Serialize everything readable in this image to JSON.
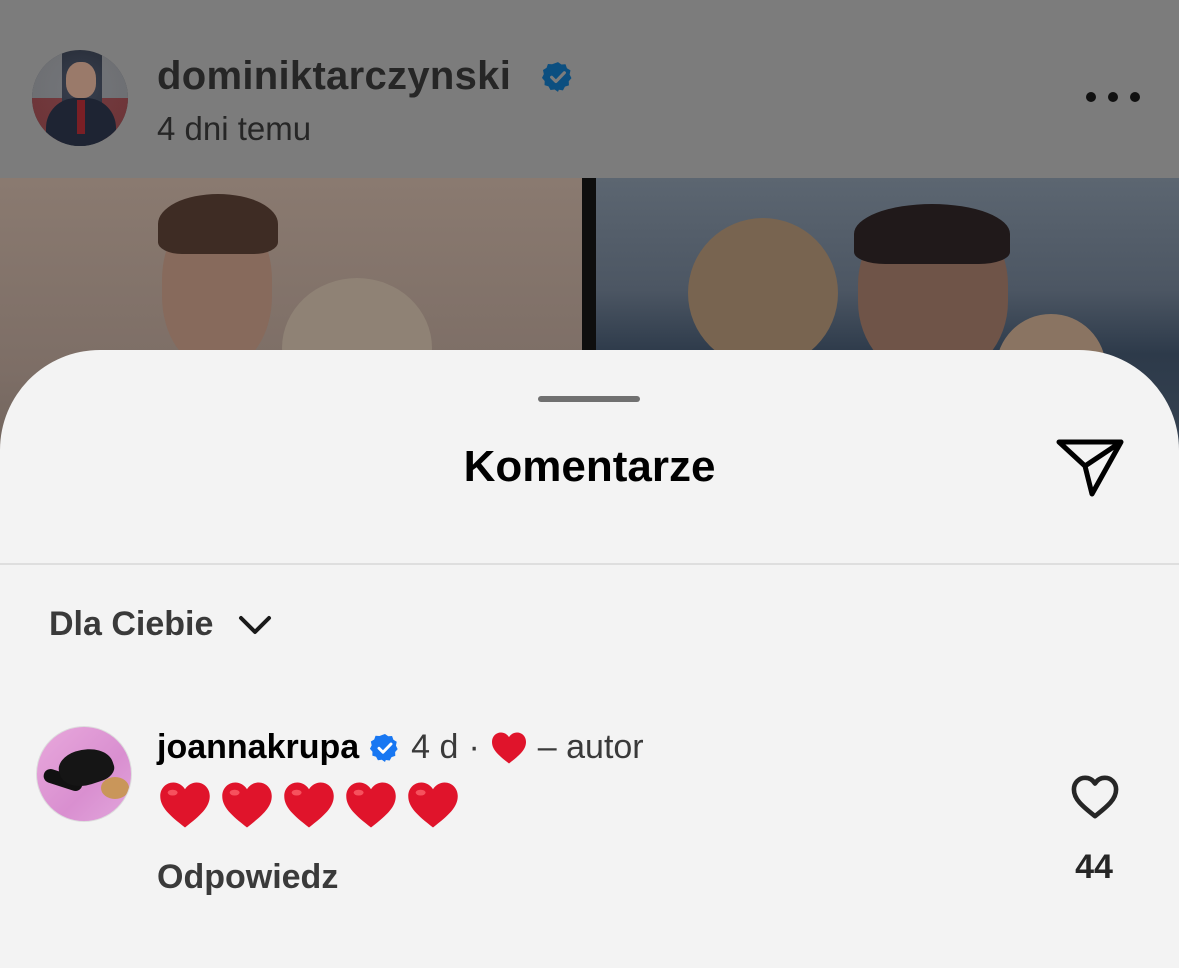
{
  "post": {
    "username": "dominiktarczynski",
    "time": "4 dni temu",
    "verified": true
  },
  "sheet": {
    "title": "Komentarze",
    "filter_label": "Dla Ciebie"
  },
  "comment": {
    "username": "joannakrupa",
    "verified": true,
    "age": "4 d",
    "separator": "·",
    "author_label": "– autor",
    "text_emoji": "❤️❤️❤️❤️❤️",
    "reply_label": "Odpowiedz",
    "like_count": "44"
  },
  "colors": {
    "verified_blue": "#1877f2",
    "heart_red": "#e0142b",
    "sheet_bg": "#f3f3f3"
  },
  "icons": {
    "more": "more-horizontal-icon",
    "share": "send-icon",
    "filter": "chevron-down-icon",
    "like": "heart-outline-icon"
  }
}
